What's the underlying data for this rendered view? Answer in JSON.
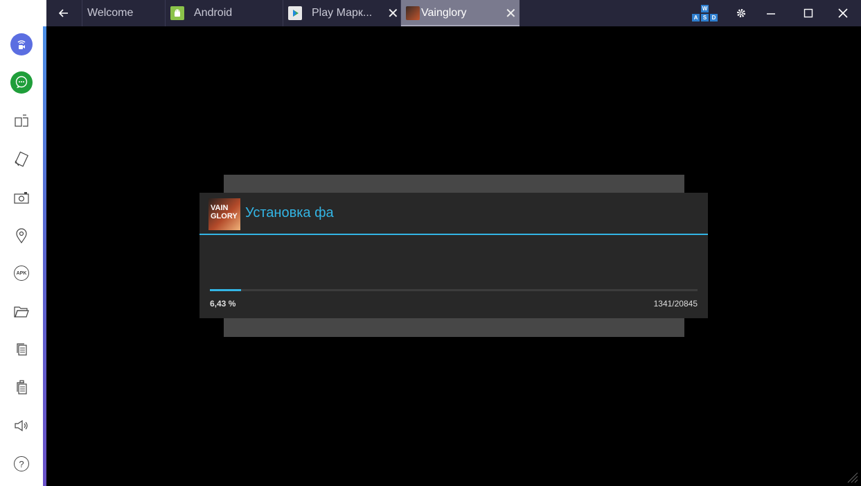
{
  "tabs": [
    {
      "label": "Welcome",
      "icon": "welcome"
    },
    {
      "label": "Android",
      "icon": "android-icon"
    },
    {
      "label": "Play Марк...",
      "icon": "play-store-icon",
      "closable": true
    },
    {
      "label": "Vainglory",
      "icon": "vainglory-icon",
      "closable": true,
      "active": true
    }
  ],
  "toolbar": {
    "wasd_keys": [
      "W",
      "A",
      "S",
      "D"
    ],
    "window_controls": [
      "settings-icon",
      "minimize-icon",
      "maximize-icon",
      "close-icon"
    ]
  },
  "sidebar": {
    "items": [
      {
        "name": "broadcast",
        "icon": "broadcast-camera-icon"
      },
      {
        "name": "chat",
        "icon": "chat-icon"
      },
      {
        "name": "multi-window",
        "icon": "multi-window-icon"
      },
      {
        "name": "rotate",
        "icon": "rotate-icon"
      },
      {
        "name": "screenshot",
        "icon": "camera-icon"
      },
      {
        "name": "location",
        "icon": "location-pin-icon"
      },
      {
        "name": "install-apk",
        "icon": "apk-icon",
        "label": "APK"
      },
      {
        "name": "open-folder",
        "icon": "folder-icon"
      },
      {
        "name": "copy",
        "icon": "copy-icon"
      },
      {
        "name": "paste",
        "icon": "paste-icon"
      },
      {
        "name": "volume",
        "icon": "speaker-icon"
      },
      {
        "name": "help",
        "icon": "help-icon",
        "label": "?"
      }
    ]
  },
  "dialog": {
    "app_icon_text": [
      "VAIN",
      "GLORY"
    ],
    "title": "Установка фа",
    "progress_percent_label": "6,43 %",
    "progress_fraction": 0.0643,
    "progress_count": "1341/20845"
  },
  "colors": {
    "accent": "#33b5e5",
    "tabstrip": "#26263a",
    "dialog_bg": "#282828"
  }
}
